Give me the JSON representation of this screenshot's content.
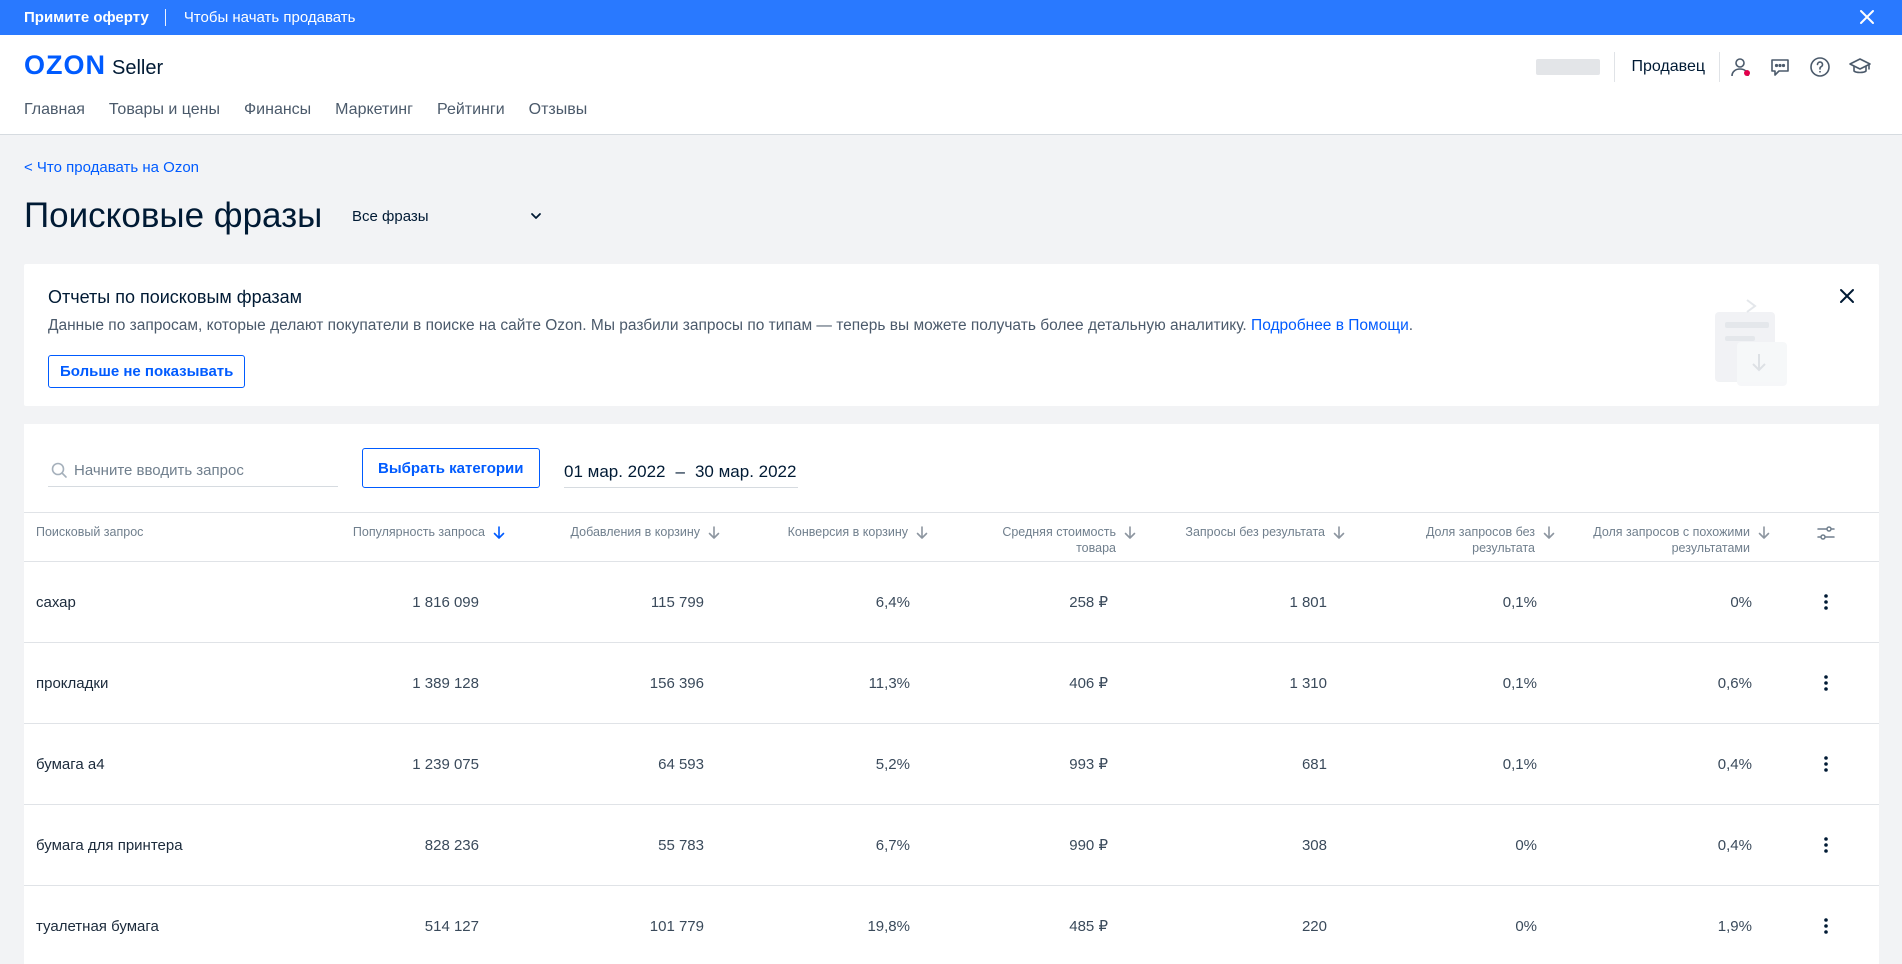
{
  "banner": {
    "offer": "Примите оферту",
    "hint": "Чтобы начать продавать"
  },
  "header": {
    "logo_brand": "OZON",
    "logo_product": "Seller",
    "role": "Продавец"
  },
  "nav": [
    "Главная",
    "Товары и цены",
    "Финансы",
    "Маркетинг",
    "Рейтинги",
    "Отзывы"
  ],
  "page": {
    "back_link": "< Что продавать на Ozon",
    "title": "Поисковые фразы",
    "phrase_filter": "Все фразы"
  },
  "info_card": {
    "title": "Отчеты по поисковым фразам",
    "text": "Данные по запросам, которые делают покупатели в поиске на сайте Ozon. Мы разбили запросы по типам — теперь вы можете получать более детальную аналитику.",
    "help_link": "Подробнее в Помощи",
    "text_end": ".",
    "dismiss_button": "Больше не показывать"
  },
  "filters": {
    "search_placeholder": "Начните вводить запрос",
    "categories_button": "Выбрать категории",
    "date_from": "01 мар. 2022",
    "date_sep": "–",
    "date_to": "30 мар. 2022"
  },
  "table": {
    "columns": [
      {
        "label": "Поисковый запрос"
      },
      {
        "label": "Популярность запроса",
        "sorted": true
      },
      {
        "label": "Добавления в корзину"
      },
      {
        "label": "Конверсия в корзину"
      },
      {
        "label": "Средняя стоимость товара"
      },
      {
        "label": "Запросы без результата"
      },
      {
        "label": "Доля запросов без результата"
      },
      {
        "label": "Доля запросов с похожими результатами"
      }
    ],
    "rows": [
      {
        "query": "сахар",
        "popularity": "1 816 099",
        "cart_adds": "115 799",
        "conversion": "6,4%",
        "avg_price": "258 ₽",
        "no_result": "1 801",
        "no_result_share": "0,1%",
        "similar_share": "0%"
      },
      {
        "query": "прокладки",
        "popularity": "1 389 128",
        "cart_adds": "156 396",
        "conversion": "11,3%",
        "avg_price": "406 ₽",
        "no_result": "1 310",
        "no_result_share": "0,1%",
        "similar_share": "0,6%"
      },
      {
        "query": "бумага а4",
        "popularity": "1 239 075",
        "cart_adds": "64 593",
        "conversion": "5,2%",
        "avg_price": "993 ₽",
        "no_result": "681",
        "no_result_share": "0,1%",
        "similar_share": "0,4%"
      },
      {
        "query": "бумага для принтера",
        "popularity": "828 236",
        "cart_adds": "55 783",
        "conversion": "6,7%",
        "avg_price": "990 ₽",
        "no_result": "308",
        "no_result_share": "0%",
        "similar_share": "0,4%"
      },
      {
        "query": "туалетная бумага",
        "popularity": "514 127",
        "cart_adds": "101 779",
        "conversion": "19,8%",
        "avg_price": "485 ₽",
        "no_result": "220",
        "no_result_share": "0%",
        "similar_share": "1,9%"
      }
    ]
  },
  "colors": {
    "accent": "#005bff",
    "banner_bg": "#2979ff",
    "notification_dot": "#e3004b"
  }
}
